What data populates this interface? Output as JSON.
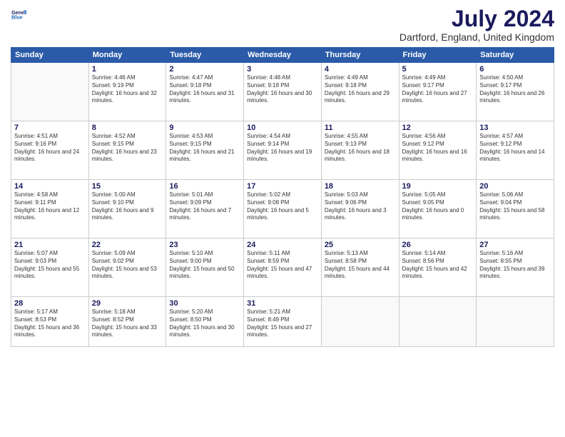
{
  "header": {
    "logo_line1": "General",
    "logo_line2": "Blue",
    "month": "July 2024",
    "location": "Dartford, England, United Kingdom"
  },
  "weekdays": [
    "Sunday",
    "Monday",
    "Tuesday",
    "Wednesday",
    "Thursday",
    "Friday",
    "Saturday"
  ],
  "weeks": [
    [
      {
        "day": "",
        "sunrise": "",
        "sunset": "",
        "daylight": ""
      },
      {
        "day": "1",
        "sunrise": "Sunrise: 4:46 AM",
        "sunset": "Sunset: 9:19 PM",
        "daylight": "Daylight: 16 hours and 32 minutes."
      },
      {
        "day": "2",
        "sunrise": "Sunrise: 4:47 AM",
        "sunset": "Sunset: 9:18 PM",
        "daylight": "Daylight: 16 hours and 31 minutes."
      },
      {
        "day": "3",
        "sunrise": "Sunrise: 4:48 AM",
        "sunset": "Sunset: 9:18 PM",
        "daylight": "Daylight: 16 hours and 30 minutes."
      },
      {
        "day": "4",
        "sunrise": "Sunrise: 4:49 AM",
        "sunset": "Sunset: 9:18 PM",
        "daylight": "Daylight: 16 hours and 29 minutes."
      },
      {
        "day": "5",
        "sunrise": "Sunrise: 4:49 AM",
        "sunset": "Sunset: 9:17 PM",
        "daylight": "Daylight: 16 hours and 27 minutes."
      },
      {
        "day": "6",
        "sunrise": "Sunrise: 4:50 AM",
        "sunset": "Sunset: 9:17 PM",
        "daylight": "Daylight: 16 hours and 26 minutes."
      }
    ],
    [
      {
        "day": "7",
        "sunrise": "Sunrise: 4:51 AM",
        "sunset": "Sunset: 9:16 PM",
        "daylight": "Daylight: 16 hours and 24 minutes."
      },
      {
        "day": "8",
        "sunrise": "Sunrise: 4:52 AM",
        "sunset": "Sunset: 9:15 PM",
        "daylight": "Daylight: 16 hours and 23 minutes."
      },
      {
        "day": "9",
        "sunrise": "Sunrise: 4:53 AM",
        "sunset": "Sunset: 9:15 PM",
        "daylight": "Daylight: 16 hours and 21 minutes."
      },
      {
        "day": "10",
        "sunrise": "Sunrise: 4:54 AM",
        "sunset": "Sunset: 9:14 PM",
        "daylight": "Daylight: 16 hours and 19 minutes."
      },
      {
        "day": "11",
        "sunrise": "Sunrise: 4:55 AM",
        "sunset": "Sunset: 9:13 PM",
        "daylight": "Daylight: 16 hours and 18 minutes."
      },
      {
        "day": "12",
        "sunrise": "Sunrise: 4:56 AM",
        "sunset": "Sunset: 9:12 PM",
        "daylight": "Daylight: 16 hours and 16 minutes."
      },
      {
        "day": "13",
        "sunrise": "Sunrise: 4:57 AM",
        "sunset": "Sunset: 9:12 PM",
        "daylight": "Daylight: 16 hours and 14 minutes."
      }
    ],
    [
      {
        "day": "14",
        "sunrise": "Sunrise: 4:58 AM",
        "sunset": "Sunset: 9:11 PM",
        "daylight": "Daylight: 16 hours and 12 minutes."
      },
      {
        "day": "15",
        "sunrise": "Sunrise: 5:00 AM",
        "sunset": "Sunset: 9:10 PM",
        "daylight": "Daylight: 16 hours and 9 minutes."
      },
      {
        "day": "16",
        "sunrise": "Sunrise: 5:01 AM",
        "sunset": "Sunset: 9:09 PM",
        "daylight": "Daylight: 16 hours and 7 minutes."
      },
      {
        "day": "17",
        "sunrise": "Sunrise: 5:02 AM",
        "sunset": "Sunset: 9:08 PM",
        "daylight": "Daylight: 16 hours and 5 minutes."
      },
      {
        "day": "18",
        "sunrise": "Sunrise: 5:03 AM",
        "sunset": "Sunset: 9:06 PM",
        "daylight": "Daylight: 16 hours and 3 minutes."
      },
      {
        "day": "19",
        "sunrise": "Sunrise: 5:05 AM",
        "sunset": "Sunset: 9:05 PM",
        "daylight": "Daylight: 16 hours and 0 minutes."
      },
      {
        "day": "20",
        "sunrise": "Sunrise: 5:06 AM",
        "sunset": "Sunset: 9:04 PM",
        "daylight": "Daylight: 15 hours and 58 minutes."
      }
    ],
    [
      {
        "day": "21",
        "sunrise": "Sunrise: 5:07 AM",
        "sunset": "Sunset: 9:03 PM",
        "daylight": "Daylight: 15 hours and 55 minutes."
      },
      {
        "day": "22",
        "sunrise": "Sunrise: 5:09 AM",
        "sunset": "Sunset: 9:02 PM",
        "daylight": "Daylight: 15 hours and 53 minutes."
      },
      {
        "day": "23",
        "sunrise": "Sunrise: 5:10 AM",
        "sunset": "Sunset: 9:00 PM",
        "daylight": "Daylight: 15 hours and 50 minutes."
      },
      {
        "day": "24",
        "sunrise": "Sunrise: 5:11 AM",
        "sunset": "Sunset: 8:59 PM",
        "daylight": "Daylight: 15 hours and 47 minutes."
      },
      {
        "day": "25",
        "sunrise": "Sunrise: 5:13 AM",
        "sunset": "Sunset: 8:58 PM",
        "daylight": "Daylight: 15 hours and 44 minutes."
      },
      {
        "day": "26",
        "sunrise": "Sunrise: 5:14 AM",
        "sunset": "Sunset: 8:56 PM",
        "daylight": "Daylight: 15 hours and 42 minutes."
      },
      {
        "day": "27",
        "sunrise": "Sunrise: 5:16 AM",
        "sunset": "Sunset: 8:55 PM",
        "daylight": "Daylight: 15 hours and 39 minutes."
      }
    ],
    [
      {
        "day": "28",
        "sunrise": "Sunrise: 5:17 AM",
        "sunset": "Sunset: 8:53 PM",
        "daylight": "Daylight: 15 hours and 36 minutes."
      },
      {
        "day": "29",
        "sunrise": "Sunrise: 5:18 AM",
        "sunset": "Sunset: 8:52 PM",
        "daylight": "Daylight: 15 hours and 33 minutes."
      },
      {
        "day": "30",
        "sunrise": "Sunrise: 5:20 AM",
        "sunset": "Sunset: 8:50 PM",
        "daylight": "Daylight: 15 hours and 30 minutes."
      },
      {
        "day": "31",
        "sunrise": "Sunrise: 5:21 AM",
        "sunset": "Sunset: 8:49 PM",
        "daylight": "Daylight: 15 hours and 27 minutes."
      },
      {
        "day": "",
        "sunrise": "",
        "sunset": "",
        "daylight": ""
      },
      {
        "day": "",
        "sunrise": "",
        "sunset": "",
        "daylight": ""
      },
      {
        "day": "",
        "sunrise": "",
        "sunset": "",
        "daylight": ""
      }
    ]
  ]
}
